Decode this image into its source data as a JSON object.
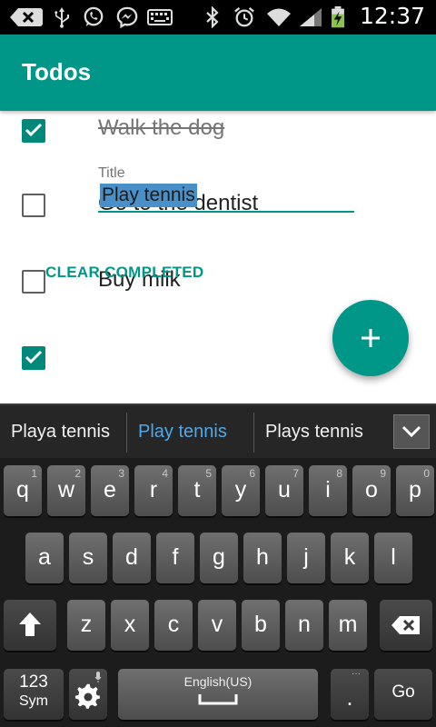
{
  "status_bar": {
    "time": "12:37"
  },
  "app_bar": {
    "title": "Todos"
  },
  "todos": [
    {
      "text": "Walk the dog",
      "completed": true
    },
    {
      "text": "Go to the dentist",
      "completed": false
    },
    {
      "text": "Buy milk",
      "completed": false
    },
    {
      "text": "",
      "completed": true
    }
  ],
  "edit": {
    "label": "Title",
    "value": "Play tennis"
  },
  "clear_button": "CLEAR COMPLETED",
  "fab": {
    "icon": "plus-icon"
  },
  "keyboard": {
    "suggestions": [
      "Playa tennis",
      "Play tennis",
      "Plays tennis"
    ],
    "row1": [
      {
        "k": "q",
        "n": "1"
      },
      {
        "k": "w",
        "n": "2"
      },
      {
        "k": "e",
        "n": "3"
      },
      {
        "k": "r",
        "n": "4"
      },
      {
        "k": "t",
        "n": "5"
      },
      {
        "k": "y",
        "n": "6"
      },
      {
        "k": "u",
        "n": "7"
      },
      {
        "k": "i",
        "n": "8"
      },
      {
        "k": "o",
        "n": "9"
      },
      {
        "k": "p",
        "n": "0"
      }
    ],
    "row2": [
      "a",
      "s",
      "d",
      "f",
      "g",
      "h",
      "j",
      "k",
      "l"
    ],
    "row3": [
      "z",
      "x",
      "c",
      "v",
      "b",
      "n",
      "m"
    ],
    "sym_label_top": "123",
    "sym_label_bottom": "Sym",
    "space_label": "English(US)",
    "period": ".",
    "go": "Go"
  }
}
